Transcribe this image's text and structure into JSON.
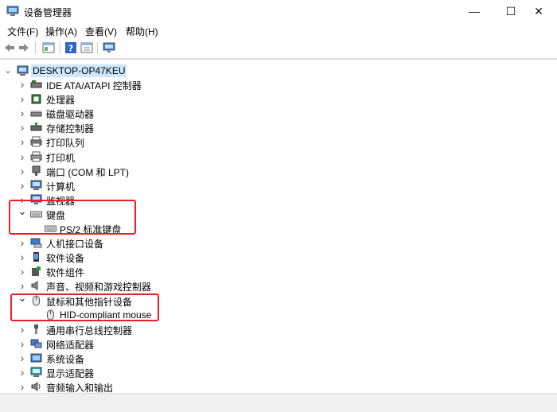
{
  "window": {
    "title": "设备管理器",
    "min_glyph": "—",
    "max_glyph": "☐",
    "close_glyph": "✕"
  },
  "menu": [
    "文件(F)",
    "操作(A)",
    "查看(V)",
    "帮助(H)"
  ],
  "tree": {
    "root": "DESKTOP-OP47KEU",
    "items": [
      {
        "label": "IDE ATA/ATAPI 控制器",
        "icon": "ide-controller-icon",
        "expanded": false
      },
      {
        "label": "处理器",
        "icon": "processor-icon",
        "expanded": false
      },
      {
        "label": "磁盘驱动器",
        "icon": "disk-drive-icon",
        "expanded": false
      },
      {
        "label": "存储控制器",
        "icon": "storage-controller-icon",
        "expanded": false
      },
      {
        "label": "打印队列",
        "icon": "print-queue-icon",
        "expanded": false
      },
      {
        "label": "打印机",
        "icon": "printer-icon",
        "expanded": false
      },
      {
        "label": "端口 (COM 和 LPT)",
        "icon": "port-icon",
        "expanded": false
      },
      {
        "label": "计算机",
        "icon": "computer-icon",
        "expanded": false
      },
      {
        "label": "监视器",
        "icon": "monitor-icon",
        "expanded": false
      },
      {
        "label": "键盘",
        "icon": "keyboard-icon",
        "expanded": true
      },
      {
        "label": "PS/2 标准键盘",
        "icon": "keyboard-icon",
        "child": true
      },
      {
        "label": "人机接口设备",
        "icon": "hid-icon",
        "expanded": false
      },
      {
        "label": "软件设备",
        "icon": "software-device-icon",
        "expanded": false
      },
      {
        "label": "软件组件",
        "icon": "software-component-icon",
        "expanded": false
      },
      {
        "label": "声音、视频和游戏控制器",
        "icon": "sound-icon",
        "expanded": false
      },
      {
        "label": "鼠标和其他指针设备",
        "icon": "mouse-icon",
        "expanded": true
      },
      {
        "label": "HID-compliant mouse",
        "icon": "mouse-icon",
        "child": true
      },
      {
        "label": "通用串行总线控制器",
        "icon": "usb-icon",
        "expanded": false
      },
      {
        "label": "网络适配器",
        "icon": "network-adapter-icon",
        "expanded": false
      },
      {
        "label": "系统设备",
        "icon": "system-device-icon",
        "expanded": false
      },
      {
        "label": "显示适配器",
        "icon": "display-adapter-icon",
        "expanded": false
      },
      {
        "label": "音频输入和输出",
        "icon": "audio-io-icon",
        "expanded": false
      }
    ]
  },
  "colors": {
    "highlight_box": "#e8202a",
    "selection": "#cce8ff"
  }
}
